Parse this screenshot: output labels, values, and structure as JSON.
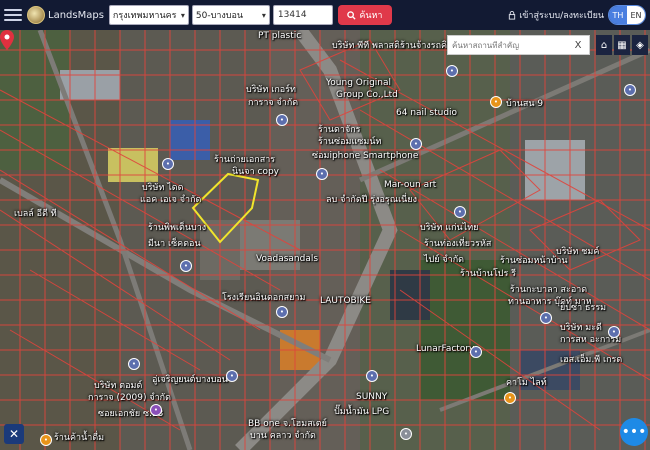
{
  "navbar": {
    "brand": "LandsMaps",
    "province": "กรุงเทพมหานคร",
    "district": "50-บางบอน",
    "parcel_value": "13414",
    "search_label": "ค้นหา",
    "login_label": "เข้าสู่ระบบ/ลงทะเบียน",
    "lang_th": "TH",
    "lang_en": "EN"
  },
  "map": {
    "search_placeholder": "ค้นหาสถานที่สำคัญ",
    "clear": "X",
    "labels": [
      {
        "text": "PT plastic"
      },
      {
        "text": "บริษัท พีที พลาสติก"
      },
      {
        "text": "ร้านจ้างรถคิดเลสท์"
      },
      {
        "text": "บริษัท เกอร์ท"
      },
      {
        "text": "การาจ จำกัด"
      },
      {
        "text": "Young Original"
      },
      {
        "text": "Group Co.,Ltd"
      },
      {
        "text": "64 nail studio"
      },
      {
        "text": "ร้านดาจักร"
      },
      {
        "text": "ร้านซ่อมแซมน์ท"
      },
      {
        "text": "ซ่อมiphone Smartphone"
      },
      {
        "text": "ร้านถ่ายเอกสาร"
      },
      {
        "text": "นินจา copy"
      },
      {
        "text": "Mar-oun art"
      },
      {
        "text": "ลบ จำกัดปี รุ่งอรุณเนี่ยง"
      },
      {
        "text": "บริษัท ไดด"
      },
      {
        "text": "แอค เอเจ จำกัด"
      },
      {
        "text": "ร้านพิพเต็นบาง"
      },
      {
        "text": "บริษัท แก่นไทย"
      },
      {
        "text": "ร้านท่องเที่ยวรหัส"
      },
      {
        "text": "ไปย์ จำกัด"
      },
      {
        "text": "Voadasandals"
      },
      {
        "text": "โรงเรียนอินดอกสยาม"
      },
      {
        "text": "LAUTOBIKE"
      },
      {
        "text": "ร้านซ่อมหน้าบ้าน"
      },
      {
        "text": "บริษัท ชมค์"
      },
      {
        "text": "ร้านบ้านโปร รี"
      },
      {
        "text": "ร้านกะบาลา สะอาด"
      },
      {
        "text": "ทานอาหาร บุ๊คท์ มาห"
      },
      {
        "text": "LunarFactory"
      },
      {
        "text": "บริษัท มะดี"
      },
      {
        "text": "การสห อะการม"
      },
      {
        "text": "เฮส.เอ็ม.พี เกรด"
      },
      {
        "text": "คาโม ไลท์"
      },
      {
        "text": "อู่เจริญยนต์บางบอน"
      },
      {
        "text": "SUNNY"
      },
      {
        "text": "ปั๊มน้ำมัน LPG"
      },
      {
        "text": "BB one จ.โฮมสเตย์"
      },
      {
        "text": "บาน คลาว จำกัด"
      },
      {
        "text": "บริษัท ตอมด์"
      },
      {
        "text": "การาจ (2009) จำกัด"
      },
      {
        "text": "ซอยเอกชัย ซ.13"
      },
      {
        "text": "ร้านค้าน้ำดื่ม"
      },
      {
        "text": "บ้านสน 9"
      },
      {
        "text": "เบลล์ อีดี ที"
      },
      {
        "text": "มีนา เซ็คดอน"
      },
      {
        "text": "ยิปซ่า ธรรม"
      }
    ]
  },
  "colors": {
    "navbar_bg": "#121a33",
    "search_button": "#e0394a",
    "parcel_line": "#e0443c",
    "selected_parcel": "#f1e52c",
    "lang_active": "#4a7fe0",
    "chat_button": "#1e8ae6"
  },
  "icons": {
    "menu": "hamburger-icon",
    "search": "magnifier-icon",
    "login": "lock-icon",
    "home": "home-icon",
    "grid": "grid-icon",
    "layers": "layers-icon",
    "tools": "tools-icon",
    "chat": "chat-icon",
    "marker": "map-marker-icon"
  }
}
